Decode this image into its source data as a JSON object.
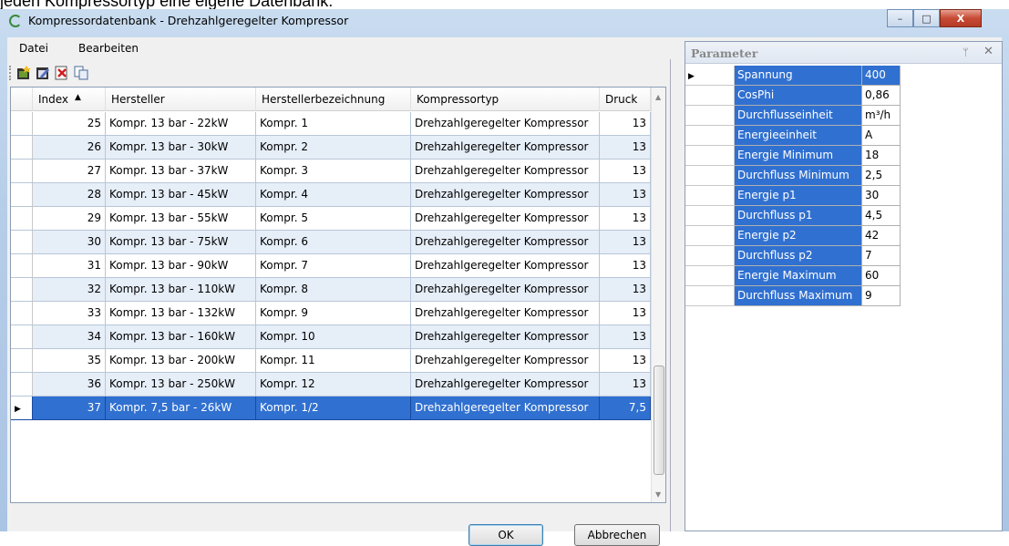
{
  "caption": "jeden Kompressortyp eine eigene Datenbank.",
  "window": {
    "title": "Kompressordatenbank - Drehzahlgeregelter Kompressor",
    "min": "–",
    "max": "□",
    "close": "X"
  },
  "menu": {
    "file": "Datei",
    "edit": "Bearbeiten"
  },
  "toolbar": {
    "icons": [
      "new-record-icon",
      "edit-record-icon",
      "delete-record-icon",
      "copy-record-icon"
    ]
  },
  "table": {
    "headers": {
      "index": "Index",
      "sort_glyph": "▲",
      "hersteller": "Hersteller",
      "bezeichnung": "Herstellerbezeichnung",
      "typ": "Kompressortyp",
      "druck": "Druck"
    },
    "rows": [
      {
        "index": "25",
        "hersteller": "Kompr. 13 bar - 22kW",
        "bezeichnung": "Kompr. 1",
        "typ": "Drehzahlgeregelter Kompressor",
        "druck": "13"
      },
      {
        "index": "26",
        "hersteller": "Kompr. 13 bar - 30kW",
        "bezeichnung": "Kompr. 2",
        "typ": "Drehzahlgeregelter Kompressor",
        "druck": "13"
      },
      {
        "index": "27",
        "hersteller": "Kompr. 13 bar - 37kW",
        "bezeichnung": "Kompr. 3",
        "typ": "Drehzahlgeregelter Kompressor",
        "druck": "13"
      },
      {
        "index": "28",
        "hersteller": "Kompr. 13 bar - 45kW",
        "bezeichnung": "Kompr. 4",
        "typ": "Drehzahlgeregelter Kompressor",
        "druck": "13"
      },
      {
        "index": "29",
        "hersteller": "Kompr. 13 bar - 55kW",
        "bezeichnung": "Kompr. 5",
        "typ": "Drehzahlgeregelter Kompressor",
        "druck": "13"
      },
      {
        "index": "30",
        "hersteller": "Kompr. 13 bar - 75kW",
        "bezeichnung": "Kompr. 6",
        "typ": "Drehzahlgeregelter Kompressor",
        "druck": "13"
      },
      {
        "index": "31",
        "hersteller": "Kompr. 13 bar - 90kW",
        "bezeichnung": "Kompr. 7",
        "typ": "Drehzahlgeregelter Kompressor",
        "druck": "13"
      },
      {
        "index": "32",
        "hersteller": "Kompr. 13 bar - 110kW",
        "bezeichnung": "Kompr. 8",
        "typ": "Drehzahlgeregelter Kompressor",
        "druck": "13"
      },
      {
        "index": "33",
        "hersteller": "Kompr. 13 bar - 132kW",
        "bezeichnung": "Kompr. 9",
        "typ": "Drehzahlgeregelter Kompressor",
        "druck": "13"
      },
      {
        "index": "34",
        "hersteller": "Kompr. 13 bar - 160kW",
        "bezeichnung": "Kompr. 10",
        "typ": "Drehzahlgeregelter Kompressor",
        "druck": "13"
      },
      {
        "index": "35",
        "hersteller": "Kompr. 13 bar - 200kW",
        "bezeichnung": "Kompr. 11",
        "typ": "Drehzahlgeregelter Kompressor",
        "druck": "13"
      },
      {
        "index": "36",
        "hersteller": "Kompr. 13 bar - 250kW",
        "bezeichnung": "Kompr. 12",
        "typ": "Drehzahlgeregelter Kompressor",
        "druck": "13"
      },
      {
        "index": "37",
        "hersteller": "Kompr. 7,5 bar - 26kW",
        "bezeichnung": "Kompr. 1/2",
        "typ": "Drehzahlgeregelter Kompressor",
        "druck": "7,5"
      }
    ],
    "selected_row": 12,
    "current_marker": "▶"
  },
  "buttons": {
    "ok": "OK",
    "cancel": "Abbrechen"
  },
  "params": {
    "title": "Parameter",
    "pin": "ᛘ",
    "close": "✕",
    "current_marker": "▶",
    "rows": [
      {
        "name": "Spannung",
        "value": "400"
      },
      {
        "name": "CosPhi",
        "value": "0,86"
      },
      {
        "name": "Durchflusseinheit",
        "value": "m³/h"
      },
      {
        "name": "Energieeinheit",
        "value": "A"
      },
      {
        "name": "Energie Minimum",
        "value": "18"
      },
      {
        "name": "Durchfluss Minimum",
        "value": "2,5"
      },
      {
        "name": "Energie p1",
        "value": "30"
      },
      {
        "name": "Durchfluss p1",
        "value": "4,5"
      },
      {
        "name": "Energie p2",
        "value": "42"
      },
      {
        "name": "Durchfluss p2",
        "value": "7"
      },
      {
        "name": "Energie Maximum",
        "value": "60"
      },
      {
        "name": "Durchfluss Maximum",
        "value": "9"
      }
    ]
  },
  "colors": {
    "selection": "#3070d0",
    "alt_row": "#e6eef8",
    "frame": "#b5cde8"
  }
}
